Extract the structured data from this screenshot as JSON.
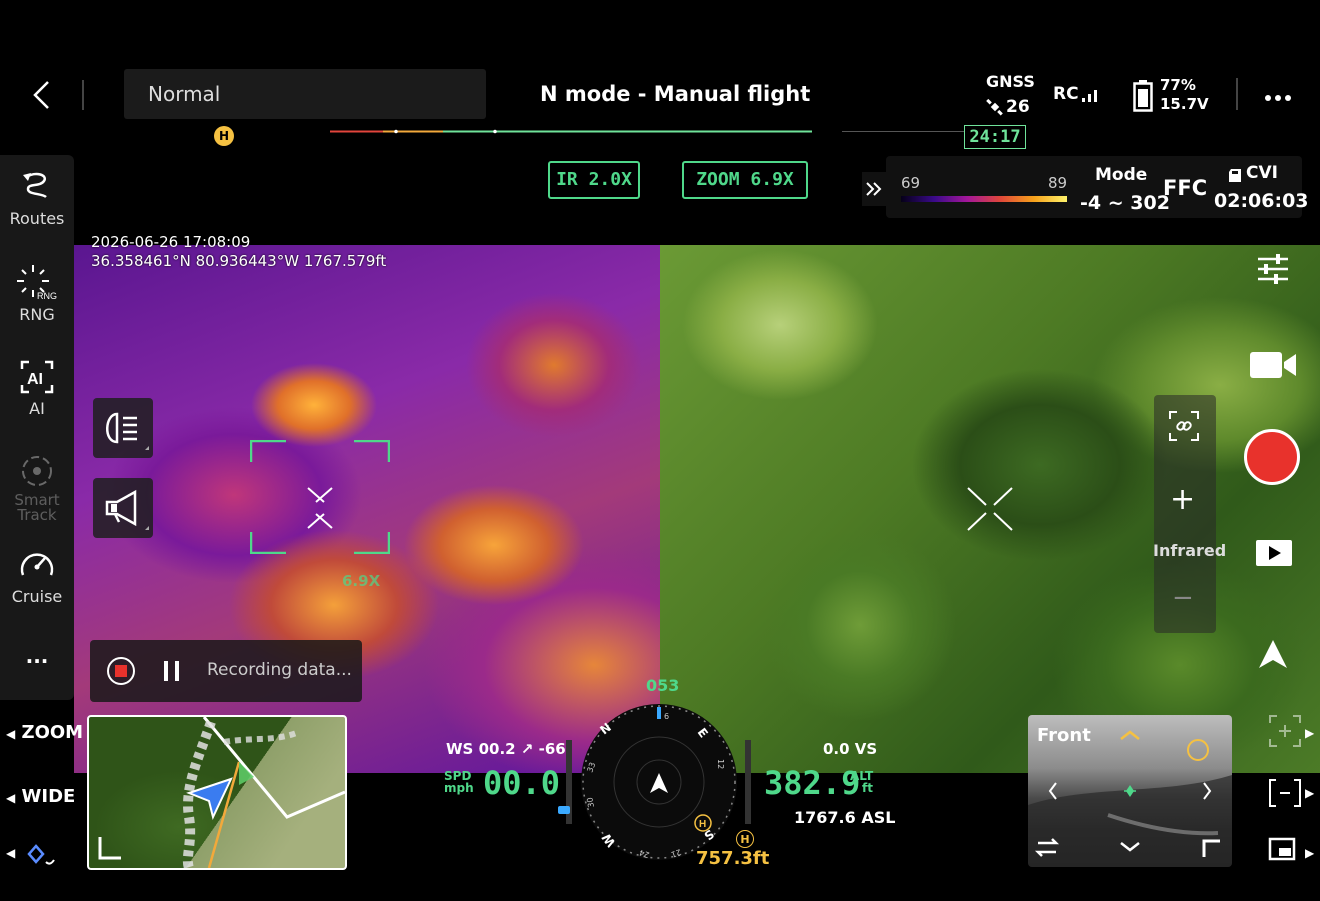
{
  "header": {
    "mode_selector": "Normal",
    "flight_mode": "N mode - Manual flight",
    "gnss_label": "GNSS",
    "gnss_satellites": "26",
    "rc_label": "RC",
    "battery_percent": "77%",
    "battery_voltage": "15.7V"
  },
  "timeline": {
    "time_remaining": "24:17"
  },
  "zoom_badges": {
    "ir": "IR  2.0X",
    "zoom": "ZOOM  6.9X"
  },
  "thermal": {
    "temp_min": "69",
    "temp_max": "89",
    "mode_label": "Mode",
    "mode_value": "-4 ~ 302",
    "ffc_label": "FFC",
    "cvi_label": "CVI",
    "cvi_time": "02:06:03"
  },
  "sidebar": {
    "items": [
      {
        "label": "Routes",
        "icon": "routes-icon"
      },
      {
        "label": "RNG",
        "icon": "rng-icon"
      },
      {
        "label": "AI",
        "icon": "ai-icon"
      },
      {
        "label": "Smart Track",
        "icon": "smart-track-icon"
      },
      {
        "label": "Cruise",
        "icon": "cruise-icon"
      },
      {
        "label": "···",
        "icon": "more-icon"
      }
    ],
    "rng_badge": "RNG",
    "ai_badge": "AI"
  },
  "feed": {
    "timestamp": "2026-06-26 17:08:09",
    "coordinates": "36.358461°N 80.936443°W 1767.579ft",
    "zoom_indicator": "6.9X"
  },
  "recording": {
    "status_text": "Recording data..."
  },
  "right_panel": {
    "infrared_label": "Infrared",
    "zoom_plus": "+",
    "zoom_minus": "−"
  },
  "bottom": {
    "zoom_label": "ZOOM",
    "wide_label": "WIDE",
    "ws_text": "WS 00.2 ↗ -66°",
    "spd_label_1": "SPD",
    "spd_label_2": "mph",
    "speed": "00.0",
    "heading": "053",
    "vs_text": "0.0  VS",
    "altitude": "382.9",
    "alt_label_1": "ALT",
    "alt_label_2": "ft",
    "asl": "1767.6 ASL",
    "home_distance": "757.3ft",
    "front_label": "Front",
    "compass_labels": [
      "N",
      "E",
      "S",
      "W"
    ],
    "compass_ticks": [
      "6",
      "12",
      "21",
      "24",
      "30",
      "33"
    ]
  },
  "colors": {
    "accent_green": "#4fd88a",
    "record_red": "#e8322c",
    "home_yellow": "#f5c142",
    "timeline_red": "#e2453c",
    "timeline_orange": "#f2a93b"
  }
}
